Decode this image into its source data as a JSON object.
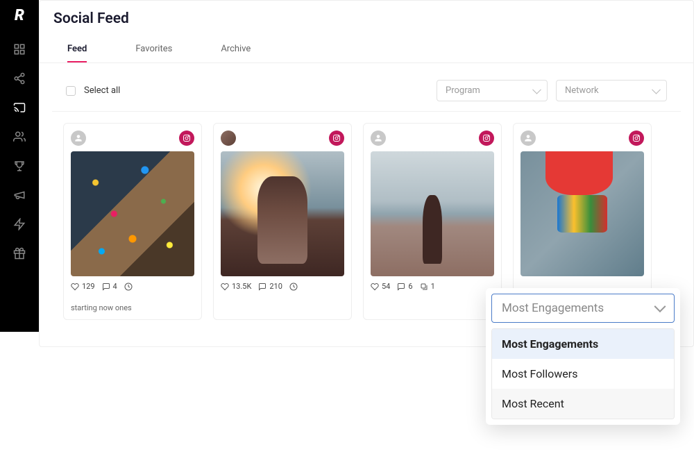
{
  "page": {
    "title": "Social Feed"
  },
  "tabs": [
    {
      "label": "Feed",
      "active": true
    },
    {
      "label": "Favorites",
      "active": false
    },
    {
      "label": "Archive",
      "active": false
    }
  ],
  "toolbar": {
    "select_all_label": "Select all",
    "filters": {
      "program": "Program",
      "network": "Network"
    }
  },
  "cards": [
    {
      "likes": "129",
      "comments": "4",
      "caption": "starting now ones"
    },
    {
      "likes": "13.5K",
      "comments": "210",
      "caption": ""
    },
    {
      "likes": "54",
      "comments": "6",
      "extra": "1",
      "caption": ""
    },
    {
      "likes": "",
      "comments": "",
      "caption": ""
    }
  ],
  "sort": {
    "selected": "Most Engagements",
    "options": [
      "Most Engagements",
      "Most Followers",
      "Most Recent"
    ]
  },
  "colors": {
    "accent": "#e91e63",
    "badge": "#c2185b",
    "focus": "#4a7bc8"
  }
}
